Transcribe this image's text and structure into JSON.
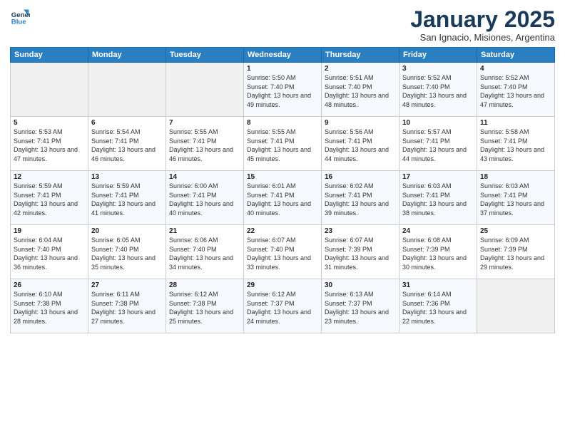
{
  "logo": {
    "line1": "General",
    "line2": "Blue"
  },
  "title": "January 2025",
  "subtitle": "San Ignacio, Misiones, Argentina",
  "days_of_week": [
    "Sunday",
    "Monday",
    "Tuesday",
    "Wednesday",
    "Thursday",
    "Friday",
    "Saturday"
  ],
  "weeks": [
    [
      {
        "day": "",
        "sunrise": "",
        "sunset": "",
        "daylight": ""
      },
      {
        "day": "",
        "sunrise": "",
        "sunset": "",
        "daylight": ""
      },
      {
        "day": "",
        "sunrise": "",
        "sunset": "",
        "daylight": ""
      },
      {
        "day": "1",
        "sunrise": "Sunrise: 5:50 AM",
        "sunset": "Sunset: 7:40 PM",
        "daylight": "Daylight: 13 hours and 49 minutes."
      },
      {
        "day": "2",
        "sunrise": "Sunrise: 5:51 AM",
        "sunset": "Sunset: 7:40 PM",
        "daylight": "Daylight: 13 hours and 48 minutes."
      },
      {
        "day": "3",
        "sunrise": "Sunrise: 5:52 AM",
        "sunset": "Sunset: 7:40 PM",
        "daylight": "Daylight: 13 hours and 48 minutes."
      },
      {
        "day": "4",
        "sunrise": "Sunrise: 5:52 AM",
        "sunset": "Sunset: 7:40 PM",
        "daylight": "Daylight: 13 hours and 47 minutes."
      }
    ],
    [
      {
        "day": "5",
        "sunrise": "Sunrise: 5:53 AM",
        "sunset": "Sunset: 7:41 PM",
        "daylight": "Daylight: 13 hours and 47 minutes."
      },
      {
        "day": "6",
        "sunrise": "Sunrise: 5:54 AM",
        "sunset": "Sunset: 7:41 PM",
        "daylight": "Daylight: 13 hours and 46 minutes."
      },
      {
        "day": "7",
        "sunrise": "Sunrise: 5:55 AM",
        "sunset": "Sunset: 7:41 PM",
        "daylight": "Daylight: 13 hours and 46 minutes."
      },
      {
        "day": "8",
        "sunrise": "Sunrise: 5:55 AM",
        "sunset": "Sunset: 7:41 PM",
        "daylight": "Daylight: 13 hours and 45 minutes."
      },
      {
        "day": "9",
        "sunrise": "Sunrise: 5:56 AM",
        "sunset": "Sunset: 7:41 PM",
        "daylight": "Daylight: 13 hours and 44 minutes."
      },
      {
        "day": "10",
        "sunrise": "Sunrise: 5:57 AM",
        "sunset": "Sunset: 7:41 PM",
        "daylight": "Daylight: 13 hours and 44 minutes."
      },
      {
        "day": "11",
        "sunrise": "Sunrise: 5:58 AM",
        "sunset": "Sunset: 7:41 PM",
        "daylight": "Daylight: 13 hours and 43 minutes."
      }
    ],
    [
      {
        "day": "12",
        "sunrise": "Sunrise: 5:59 AM",
        "sunset": "Sunset: 7:41 PM",
        "daylight": "Daylight: 13 hours and 42 minutes."
      },
      {
        "day": "13",
        "sunrise": "Sunrise: 5:59 AM",
        "sunset": "Sunset: 7:41 PM",
        "daylight": "Daylight: 13 hours and 41 minutes."
      },
      {
        "day": "14",
        "sunrise": "Sunrise: 6:00 AM",
        "sunset": "Sunset: 7:41 PM",
        "daylight": "Daylight: 13 hours and 40 minutes."
      },
      {
        "day": "15",
        "sunrise": "Sunrise: 6:01 AM",
        "sunset": "Sunset: 7:41 PM",
        "daylight": "Daylight: 13 hours and 40 minutes."
      },
      {
        "day": "16",
        "sunrise": "Sunrise: 6:02 AM",
        "sunset": "Sunset: 7:41 PM",
        "daylight": "Daylight: 13 hours and 39 minutes."
      },
      {
        "day": "17",
        "sunrise": "Sunrise: 6:03 AM",
        "sunset": "Sunset: 7:41 PM",
        "daylight": "Daylight: 13 hours and 38 minutes."
      },
      {
        "day": "18",
        "sunrise": "Sunrise: 6:03 AM",
        "sunset": "Sunset: 7:41 PM",
        "daylight": "Daylight: 13 hours and 37 minutes."
      }
    ],
    [
      {
        "day": "19",
        "sunrise": "Sunrise: 6:04 AM",
        "sunset": "Sunset: 7:40 PM",
        "daylight": "Daylight: 13 hours and 36 minutes."
      },
      {
        "day": "20",
        "sunrise": "Sunrise: 6:05 AM",
        "sunset": "Sunset: 7:40 PM",
        "daylight": "Daylight: 13 hours and 35 minutes."
      },
      {
        "day": "21",
        "sunrise": "Sunrise: 6:06 AM",
        "sunset": "Sunset: 7:40 PM",
        "daylight": "Daylight: 13 hours and 34 minutes."
      },
      {
        "day": "22",
        "sunrise": "Sunrise: 6:07 AM",
        "sunset": "Sunset: 7:40 PM",
        "daylight": "Daylight: 13 hours and 33 minutes."
      },
      {
        "day": "23",
        "sunrise": "Sunrise: 6:07 AM",
        "sunset": "Sunset: 7:39 PM",
        "daylight": "Daylight: 13 hours and 31 minutes."
      },
      {
        "day": "24",
        "sunrise": "Sunrise: 6:08 AM",
        "sunset": "Sunset: 7:39 PM",
        "daylight": "Daylight: 13 hours and 30 minutes."
      },
      {
        "day": "25",
        "sunrise": "Sunrise: 6:09 AM",
        "sunset": "Sunset: 7:39 PM",
        "daylight": "Daylight: 13 hours and 29 minutes."
      }
    ],
    [
      {
        "day": "26",
        "sunrise": "Sunrise: 6:10 AM",
        "sunset": "Sunset: 7:38 PM",
        "daylight": "Daylight: 13 hours and 28 minutes."
      },
      {
        "day": "27",
        "sunrise": "Sunrise: 6:11 AM",
        "sunset": "Sunset: 7:38 PM",
        "daylight": "Daylight: 13 hours and 27 minutes."
      },
      {
        "day": "28",
        "sunrise": "Sunrise: 6:12 AM",
        "sunset": "Sunset: 7:38 PM",
        "daylight": "Daylight: 13 hours and 25 minutes."
      },
      {
        "day": "29",
        "sunrise": "Sunrise: 6:12 AM",
        "sunset": "Sunset: 7:37 PM",
        "daylight": "Daylight: 13 hours and 24 minutes."
      },
      {
        "day": "30",
        "sunrise": "Sunrise: 6:13 AM",
        "sunset": "Sunset: 7:37 PM",
        "daylight": "Daylight: 13 hours and 23 minutes."
      },
      {
        "day": "31",
        "sunrise": "Sunrise: 6:14 AM",
        "sunset": "Sunset: 7:36 PM",
        "daylight": "Daylight: 13 hours and 22 minutes."
      },
      {
        "day": "",
        "sunrise": "",
        "sunset": "",
        "daylight": ""
      }
    ]
  ]
}
